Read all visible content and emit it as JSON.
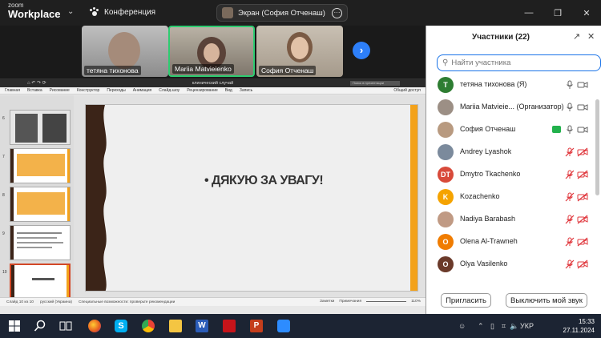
{
  "zoom": {
    "brand_small": "zoom",
    "brand_large": "Workplace",
    "meeting_label": "Конференция",
    "screen_share_label": "Экран (София Отченаш)"
  },
  "video_tiles": [
    {
      "name": "тетяна тихонова"
    },
    {
      "name": "Mariia Matvieienko"
    },
    {
      "name": "София Отченаш"
    }
  ],
  "powerpoint": {
    "title": "клинический случай",
    "search_placeholder": "Поиск в презентации",
    "menu": [
      "Главная",
      "Вставка",
      "Рисование",
      "Конструктор",
      "Переходы",
      "Анимация",
      "Слайд-шоу",
      "Рецензирование",
      "Вид",
      "Запись"
    ],
    "share_label": "Общий доступ",
    "slide_text": "ДЯКУЮ ЗА УВАГУ!",
    "thumb_numbers": [
      "6",
      "7",
      "8",
      "9",
      "10"
    ],
    "status": {
      "slide": "Слайд 10 из 10",
      "language": "русский (Украина)",
      "accessibility": "Специальные возможности: проверьте рекомендации",
      "notes": "Заметки",
      "comments": "Примечания",
      "zoom": "110%"
    }
  },
  "panel": {
    "title": "Участники (22)",
    "search_placeholder": "Найти участника",
    "participants": [
      {
        "name": "тетяна тихонова (Я)",
        "initial": "Т",
        "color": "#2e7d32",
        "photo": false,
        "mic_muted": false,
        "cam_off": false
      },
      {
        "name": "Mariia Matvieie... (Организатор)",
        "initial": "",
        "color": "#9c8f85",
        "photo": true,
        "mic_muted": false,
        "cam_off": false
      },
      {
        "name": "София Отченаш",
        "initial": "",
        "color": "#b89a80",
        "photo": true,
        "mic_muted": false,
        "cam_off": false,
        "sharing": true
      },
      {
        "name": "Andrey Lyashok",
        "initial": "",
        "color": "#7b8a9c",
        "photo": true,
        "mic_muted": true,
        "cam_off": true
      },
      {
        "name": "Dmytro Tkachenko",
        "initial": "DT",
        "color": "#d84a3a",
        "photo": false,
        "mic_muted": true,
        "cam_off": true
      },
      {
        "name": "Kozachenko",
        "initial": "K",
        "color": "#f5a300",
        "photo": false,
        "mic_muted": true,
        "cam_off": true
      },
      {
        "name": "Nadiya Barabash",
        "initial": "",
        "color": "#c09a84",
        "photo": true,
        "mic_muted": true,
        "cam_off": true
      },
      {
        "name": "Olena Al-Trawneh",
        "initial": "O",
        "color": "#f07c00",
        "photo": false,
        "mic_muted": true,
        "cam_off": true
      },
      {
        "name": "Olya Vasilenko",
        "initial": "O",
        "color": "#6b3a2a",
        "photo": false,
        "mic_muted": true,
        "cam_off": true
      }
    ],
    "invite_label": "Пригласить",
    "mute_all_label": "Выключить мой звук"
  },
  "taskbar": {
    "lang": "УКР",
    "time": "15:33",
    "date": "27.11.2024"
  },
  "colors": {
    "accent": "#1a73e8",
    "slide_orange": "#f3a21b",
    "slide_brown": "#3b2418",
    "mute_red": "#e0383e"
  }
}
